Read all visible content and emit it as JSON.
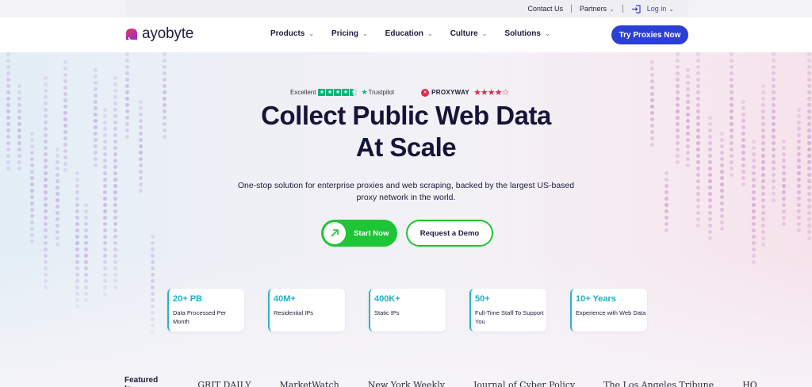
{
  "utility": {
    "contact": "Contact Us",
    "partners": "Partners",
    "login": "Log in"
  },
  "brand": {
    "name": "ayobyte"
  },
  "nav": {
    "items": [
      {
        "label": "Products"
      },
      {
        "label": "Pricing"
      },
      {
        "label": "Education"
      },
      {
        "label": "Culture"
      },
      {
        "label": "Solutions"
      }
    ],
    "cta": "Try Proxies Now"
  },
  "ratings": {
    "excellent": "Excellent",
    "trustpilot": "Trustpilot",
    "trustpilot_stars": 4.5,
    "proxyway": "PROXYWAY",
    "proxyway_stars": "★★★★☆"
  },
  "hero": {
    "title_line1": "Collect Public Web Data",
    "title_line2": "At Scale",
    "subtitle_line1": "One-stop solution for enterprise proxies and web scraping, backed by the largest US-based",
    "subtitle_line2": "proxy network in the world.",
    "start": "Start Now",
    "demo": "Request a Demo"
  },
  "stats": [
    {
      "value": "20+ PB",
      "label": "Data Processed Per Month"
    },
    {
      "value": "40M+",
      "label": "Residential IPs"
    },
    {
      "value": "400K+",
      "label": "Static IPs"
    },
    {
      "value": "50+",
      "label": "Full-Time Staff To Support You"
    },
    {
      "value": "10+ Years",
      "label": "Experience with Web Data"
    }
  ],
  "featured": {
    "label": "Featured In",
    "logos": [
      "GRIT DAILY",
      "MarketWatch",
      "New York Weekly",
      "Journal of Cyber Policy",
      "The Los Angeles Tribune",
      "HO"
    ]
  },
  "colors": {
    "accent": "#2a3fd4",
    "green": "#1ec534",
    "teal": "#1fb0c4",
    "dots_left": "#c9b6e6",
    "dots_right": "#d8a8d8"
  }
}
